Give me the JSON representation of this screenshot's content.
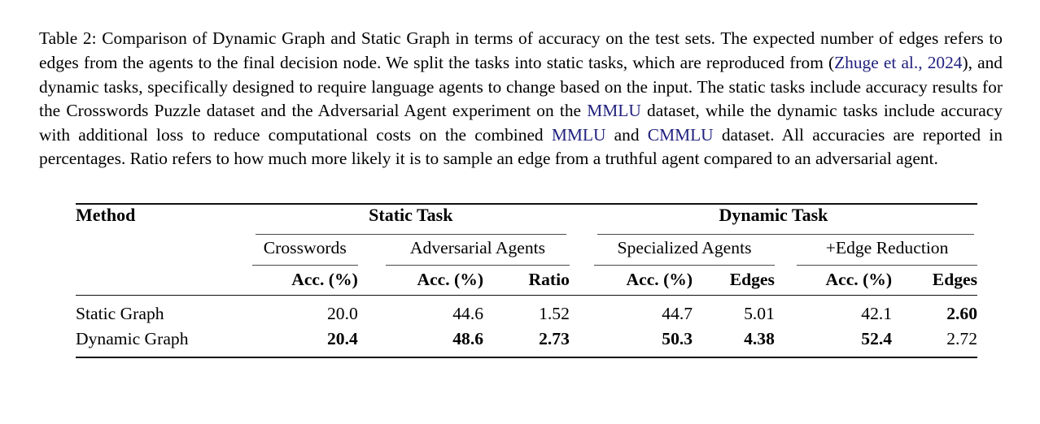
{
  "caption": {
    "segments": [
      {
        "t": "Table 2: Comparison of Dynamic Graph and Static Graph in terms of accuracy on the test sets. The expected number of edges refers to edges from the agents to the final decision node. We split the tasks into static tasks, which are reproduced from (",
        "cite": false
      },
      {
        "t": "Zhuge et al., 2024",
        "cite": true
      },
      {
        "t": "), and dynamic tasks, specifically designed to require language agents to change based on the input. The static tasks include accuracy results for the Crosswords Puzzle dataset and the Adversarial Agent experiment on the ",
        "cite": false
      },
      {
        "t": "MMLU",
        "cite": true
      },
      {
        "t": " dataset, while the dynamic tasks include accuracy with additional loss to reduce computational costs on the combined ",
        "cite": false
      },
      {
        "t": "MMLU",
        "cite": true
      },
      {
        "t": " and ",
        "cite": false
      },
      {
        "t": "CMMLU",
        "cite": true
      },
      {
        "t": " dataset. All accuracies are reported in percentages. Ratio refers to how much more likely it is to sample an edge from a truthful agent compared to an adversarial agent.",
        "cite": false
      }
    ],
    "cite_color": "#21217f"
  },
  "table": {
    "method_header": "Method",
    "group_headers": [
      {
        "label": "Static Task",
        "span": "crosswords+adversarial"
      },
      {
        "label": "Dynamic Task",
        "span": "specialized+edge-reduction"
      }
    ],
    "sub_headers": [
      {
        "label": "Crosswords"
      },
      {
        "label": "Adversarial Agents"
      },
      {
        "label": "Specialized Agents"
      },
      {
        "label": "+Edge Reduction"
      }
    ],
    "column_headers": [
      {
        "label": "Acc. (%)"
      },
      {
        "label": "Acc. (%)"
      },
      {
        "label": "Ratio"
      },
      {
        "label": "Acc. (%)"
      },
      {
        "label": "Edges"
      },
      {
        "label": "Acc. (%)"
      },
      {
        "label": "Edges"
      }
    ],
    "rows": [
      {
        "method": "Static Graph",
        "method_bold": false,
        "cells": [
          {
            "v": "20.0",
            "bold": false
          },
          {
            "v": "44.6",
            "bold": false
          },
          {
            "v": "1.52",
            "bold": false
          },
          {
            "v": "44.7",
            "bold": false
          },
          {
            "v": "5.01",
            "bold": false
          },
          {
            "v": "42.1",
            "bold": false
          },
          {
            "v": "2.60",
            "bold": true
          }
        ]
      },
      {
        "method": "Dynamic Graph",
        "method_bold": false,
        "cells": [
          {
            "v": "20.4",
            "bold": true
          },
          {
            "v": "48.6",
            "bold": true
          },
          {
            "v": "2.73",
            "bold": true
          },
          {
            "v": "50.3",
            "bold": true
          },
          {
            "v": "4.38",
            "bold": true
          },
          {
            "v": "52.4",
            "bold": true
          },
          {
            "v": "2.72",
            "bold": false
          }
        ]
      }
    ]
  }
}
